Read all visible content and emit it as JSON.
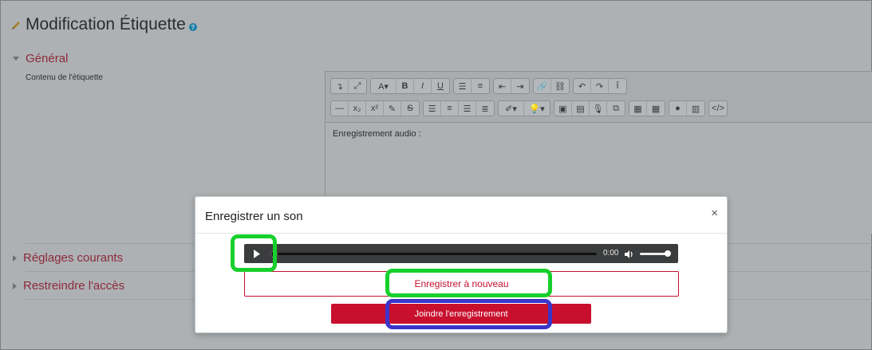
{
  "page": {
    "title": "Modification Étiquette",
    "help_glyph": "?"
  },
  "sections": {
    "general": "Général",
    "common": "Réglages courants",
    "restrict": "Restreindre l'accès"
  },
  "form": {
    "content_label": "Contenu de l'étiquette"
  },
  "editor": {
    "toolbar_row1": [
      [
        "indent-arrow-icon",
        "fullscreen-icon"
      ],
      [
        "font-style-icon",
        "bold-icon",
        "italic-icon",
        "underline-icon"
      ],
      [
        "unordered-list-icon",
        "ordered-list-icon"
      ],
      [
        "outdent-icon",
        "indent-icon"
      ],
      [
        "link-icon",
        "unlink-icon"
      ],
      [
        "undo-icon",
        "redo-icon",
        "clear-format-icon"
      ]
    ],
    "toolbar_row2": [
      [
        "horizontal-rule-icon",
        "subscript-icon",
        "superscript-icon",
        "edit-icon",
        "strikethrough-icon"
      ],
      [
        "align-left-icon",
        "align-center-icon",
        "align-right-icon",
        "align-justify-icon"
      ],
      [
        "brush-icon",
        "lightbulb-icon"
      ],
      [
        "image-icon",
        "media-icon",
        "microphone-icon",
        "copy-icon"
      ],
      [
        "calculator-icon",
        "table-icon"
      ],
      [
        "accessibility-icon",
        "grid-icon"
      ],
      [
        "html-code-icon"
      ]
    ],
    "content_text": "Enregistrement audio :"
  },
  "modal": {
    "title": "Enregistrer un son",
    "close_glyph": "×",
    "player": {
      "time": "0:00",
      "volume": 1.0,
      "progress": 0.0
    },
    "rerecord_label": "Enregistrer à nouveau",
    "attach_label": "Joindre l'enregistrement"
  },
  "colors": {
    "accent": "#c8102e",
    "highlight_green": "#18d02c",
    "highlight_blue": "#3a34c9"
  }
}
